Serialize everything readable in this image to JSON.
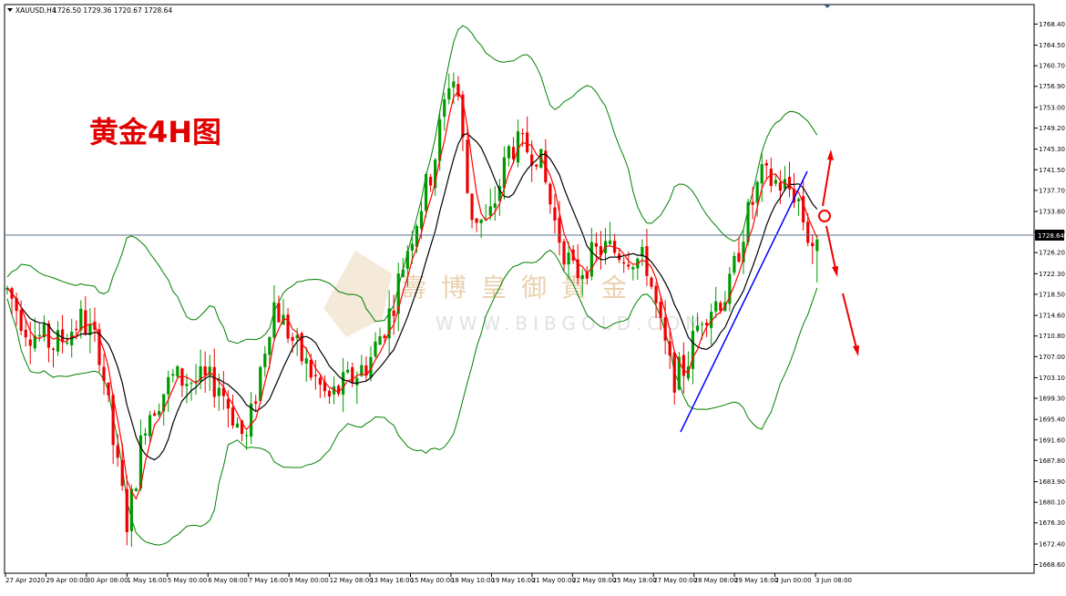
{
  "header": {
    "symbol": "XAUUSD,H4",
    "ohlc": "1726.50 1729.36 1720.67 1728.64"
  },
  "annotation": {
    "title": "黄金4H图",
    "watermark_cn": "壽博皇御貴金",
    "watermark_url": "WWW.BIBGOLD.COM"
  },
  "colors": {
    "bull": "#009900",
    "bear": "#ee0000",
    "ma_fast": "#ff0000",
    "ma_slow": "#000000",
    "bands": "#008000",
    "trendline": "#0000ff",
    "arrows": "#ee0000",
    "price_line": "#5a7184"
  },
  "chart_data": {
    "type": "candlestick",
    "symbol": "XAUUSD",
    "timeframe": "H4",
    "current_price": 1728.64,
    "current_price_label": "1728.64",
    "ylim": [
      1667.0,
      1772.0
    ],
    "y_ticks": [
      "1768.40",
      "1764.50",
      "1760.70",
      "1756.90",
      "1753.00",
      "1749.20",
      "1745.30",
      "1741.50",
      "1737.70",
      "1733.80",
      "1730.00",
      "1726.20",
      "1722.30",
      "1718.50",
      "1714.60",
      "1710.80",
      "1707.00",
      "1703.10",
      "1699.30",
      "1695.40",
      "1691.60",
      "1687.80",
      "1683.90",
      "1680.10",
      "1676.30",
      "1672.40",
      "1668.60"
    ],
    "x_ticks": [
      "27 Apr 2020",
      "29 Apr 00:00",
      "30 Apr 08:00",
      "1 May 16:00",
      "5 May 00:00",
      "6 May 08:00",
      "7 May 16:00",
      "9 May 00:00",
      "12 May 08:00",
      "13 May 16:00",
      "15 May 00:00",
      "18 May 10:00",
      "19 May 16:00",
      "21 May 00:00",
      "22 May 08:00",
      "25 May 18:00",
      "27 May 00:00",
      "28 May 08:00",
      "29 May 16:00",
      "2 Jun 00:00",
      "3 Jun 08:00"
    ],
    "legend": "none",
    "grid": false,
    "indicators": [
      "Bollinger Bands (upper/middle/lower)",
      "fast moving average",
      "slow moving average"
    ]
  }
}
